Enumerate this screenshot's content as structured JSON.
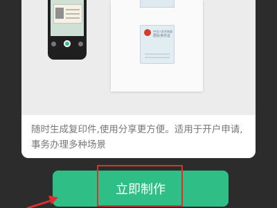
{
  "feature": {
    "description": "随时生成复印件,使用分享更方便。适用于开户申请,事务办理多种场景",
    "id_card_front_title": "中华人民共和国",
    "id_card_front_name": "居民身份证"
  },
  "actions": {
    "create_now_label": "立即制作"
  },
  "colors": {
    "accent": "#2fbf86",
    "highlight": "#e02d2d",
    "background": "#2d2c2c"
  },
  "icons": [
    "phone-scan-illustration",
    "id-card-illustration",
    "arrow-pointer-icon"
  ]
}
